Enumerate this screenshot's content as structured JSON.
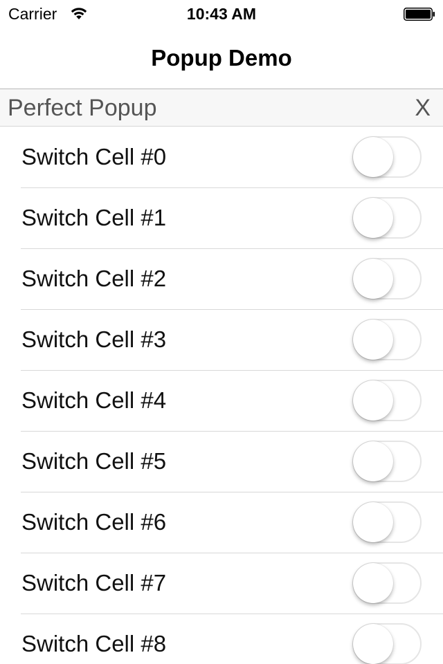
{
  "status_bar": {
    "carrier": "Carrier",
    "time": "10:43 AM",
    "wifi_icon": "wifi-icon",
    "battery_icon": "battery-icon"
  },
  "nav": {
    "title": "Popup Demo"
  },
  "popup": {
    "title": "Perfect Popup",
    "close_label": "X"
  },
  "cells": [
    {
      "label": "Switch Cell #0",
      "on": false
    },
    {
      "label": "Switch Cell #1",
      "on": false
    },
    {
      "label": "Switch Cell #2",
      "on": false
    },
    {
      "label": "Switch Cell #3",
      "on": false
    },
    {
      "label": "Switch Cell #4",
      "on": false
    },
    {
      "label": "Switch Cell #5",
      "on": false
    },
    {
      "label": "Switch Cell #6",
      "on": false
    },
    {
      "label": "Switch Cell #7",
      "on": false
    },
    {
      "label": "Switch Cell #8",
      "on": false
    }
  ],
  "colors": {
    "separator": "#d8d8d8",
    "popup_header_bg": "#f7f7f7",
    "switch_off_border": "#e5e5e5"
  }
}
